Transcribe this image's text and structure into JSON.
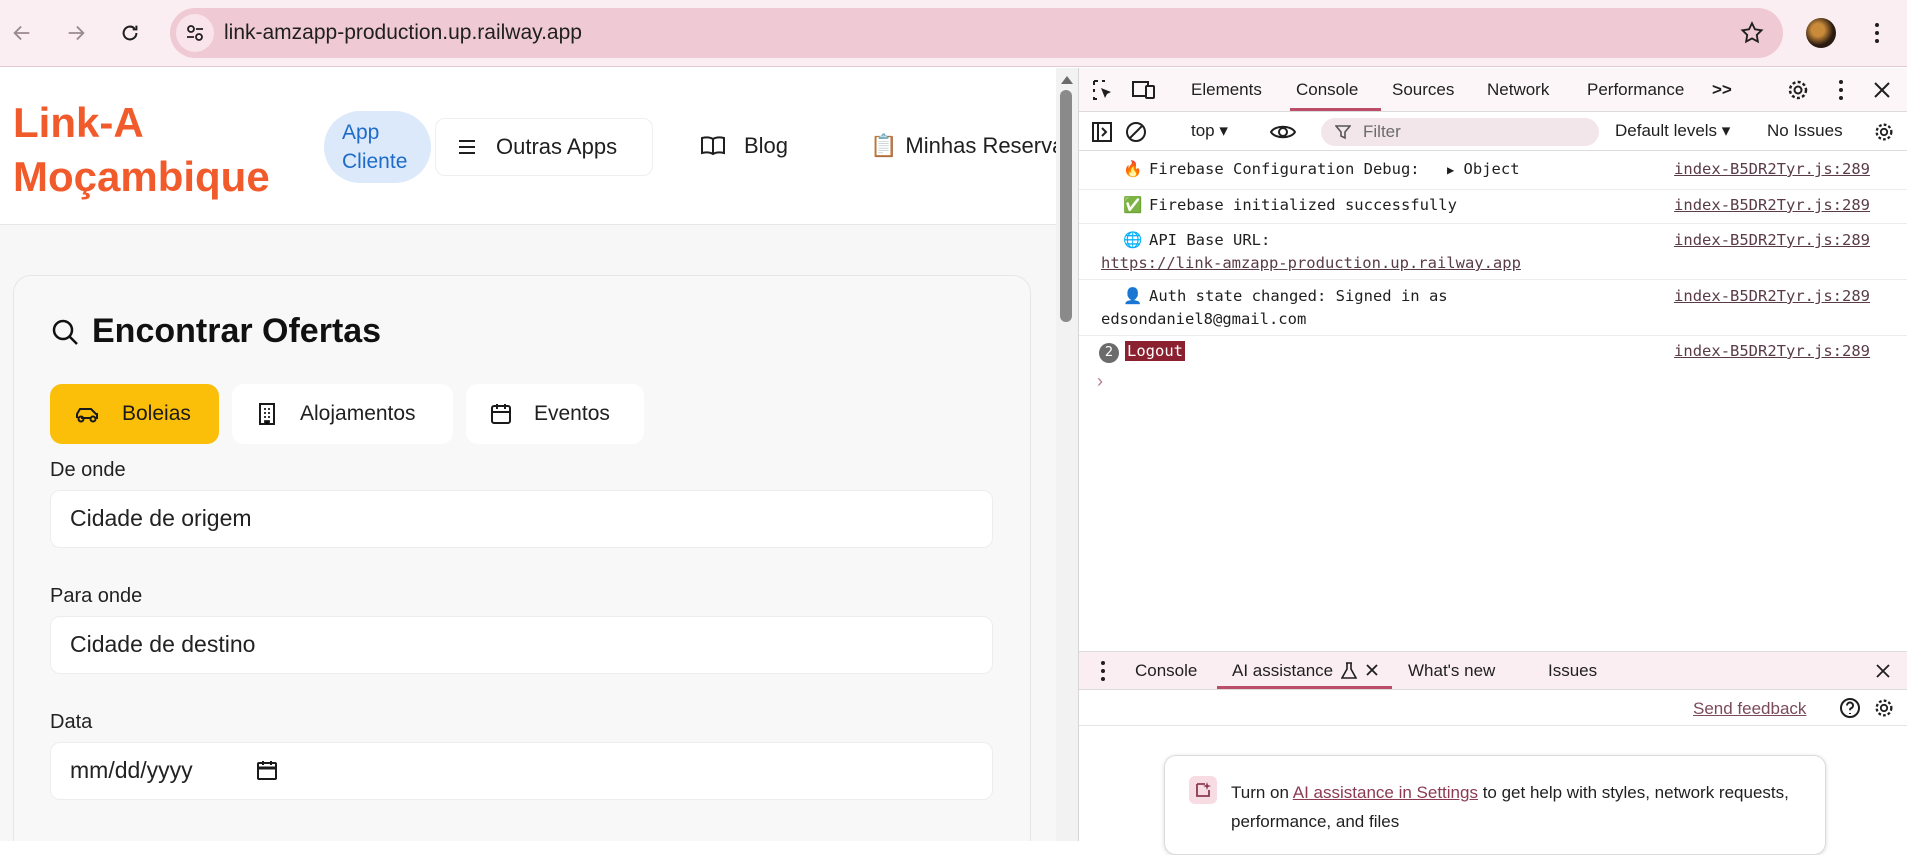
{
  "browser": {
    "url": "link-amzapp-production.up.railway.app"
  },
  "header": {
    "logo_line1": "Link-A",
    "logo_line2": "Moçambique",
    "app_cliente_line1": "App",
    "app_cliente_line2": "Cliente",
    "outras_apps": "Outras Apps",
    "blog": "Blog",
    "minhas_reservas": "Minhas Reservas",
    "reservas_emoji": "📋"
  },
  "search": {
    "title": "Encontrar Ofertas",
    "tabs": [
      {
        "label": "Boleias",
        "active": true
      },
      {
        "label": "Alojamentos",
        "active": false
      },
      {
        "label": "Eventos",
        "active": false
      }
    ],
    "from_label": "De onde",
    "from_placeholder": "Cidade de origem",
    "to_label": "Para onde",
    "to_placeholder": "Cidade de destino",
    "date_label": "Data",
    "date_placeholder": "mm/dd/yyyy"
  },
  "devtools": {
    "tabs": [
      "Elements",
      "Console",
      "Sources",
      "Network",
      "Performance"
    ],
    "active_tab": "Console",
    "context": "top",
    "filter_placeholder": "Filter",
    "levels": "Default levels",
    "issues": "No Issues",
    "logs": [
      {
        "emoji": "🔥",
        "text": "Firebase Configuration Debug:",
        "extra": "Object",
        "source": "index-B5DR2Tyr.js:289"
      },
      {
        "emoji": "✅",
        "text": "Firebase initialized successfully",
        "source": "index-B5DR2Tyr.js:289"
      },
      {
        "emoji": "🌐",
        "text": "API Base URL:",
        "link": "https://link-amzapp-production.up.railway.app",
        "source": "index-B5DR2Tyr.js:289"
      },
      {
        "emoji": "👤",
        "text": "Auth state changed: Signed in as",
        "line2": "edsondaniel8@gmail.com",
        "source": "index-B5DR2Tyr.js:289"
      },
      {
        "count": "2",
        "text": "Logout",
        "source": "index-B5DR2Tyr.js:289"
      }
    ],
    "drawer_tabs": [
      "Console",
      "AI assistance",
      "What's new",
      "Issues"
    ],
    "send_feedback": "Send feedback",
    "ai_text_before": "Turn on ",
    "ai_link": "AI assistance in Settings",
    "ai_text_after": " to get help with styles, network requests, performance, and files"
  },
  "colors": {
    "brand": "#f15a2b",
    "active_tab": "#fbbf0a",
    "devtools_accent": "#b94d6a"
  }
}
